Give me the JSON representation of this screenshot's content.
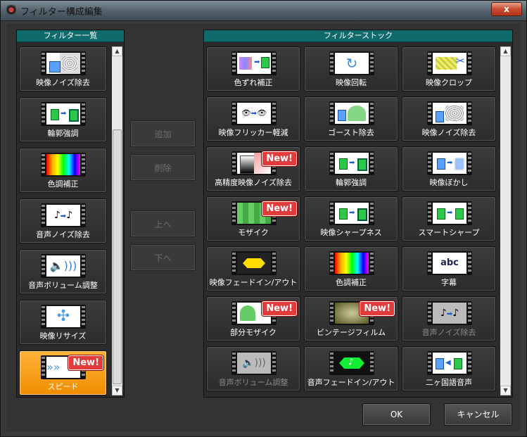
{
  "window": {
    "title": "フィルター構成編集",
    "close_label": "x"
  },
  "left_panel": {
    "header": "フィルター一覧",
    "items": [
      {
        "label": "映像ノイズ除去",
        "icon": "noise-icon"
      },
      {
        "label": "輪郭強調",
        "icon": "edge-icon"
      },
      {
        "label": "色調補正",
        "icon": "color-icon"
      },
      {
        "label": "音声ノイズ除去",
        "icon": "audio-noise-icon"
      },
      {
        "label": "音声ボリューム調整",
        "icon": "volume-icon"
      },
      {
        "label": "映像リサイズ",
        "icon": "resize-icon"
      },
      {
        "label": "スピード",
        "icon": "speed-icon",
        "badge": "New!"
      }
    ]
  },
  "middle_buttons": {
    "add": "追加",
    "delete": "削除",
    "up": "上へ",
    "down": "下へ"
  },
  "right_panel": {
    "header": "フィルターストック",
    "items": [
      {
        "label": "色ずれ補正"
      },
      {
        "label": "映像回転"
      },
      {
        "label": "映像クロップ"
      },
      {
        "label": "映像フリッカー軽減"
      },
      {
        "label": "ゴースト除去"
      },
      {
        "label": "映像ノイズ除去"
      },
      {
        "label": "高精度映像ノイズ除去",
        "badge": "New!"
      },
      {
        "label": "輪郭強調"
      },
      {
        "label": "映像ぼかし"
      },
      {
        "label": "モザイク",
        "badge": "New!"
      },
      {
        "label": "映像シャープネス"
      },
      {
        "label": "スマートシャープ"
      },
      {
        "label": "映像フェードイン/アウト"
      },
      {
        "label": "色調補正"
      },
      {
        "label": "字幕"
      },
      {
        "label": "部分モザイク",
        "badge": "New!"
      },
      {
        "label": "ビンテージフィルム",
        "badge": "New!"
      },
      {
        "label": "音声ノイズ除去"
      },
      {
        "label": "音声ボリューム調整"
      },
      {
        "label": "音声フェードイン/アウト"
      },
      {
        "label": "二ヶ国語音声"
      }
    ],
    "subtitle_icon_text": "abc"
  },
  "dialog_buttons": {
    "ok": "OK",
    "cancel": "キャンセル"
  },
  "colors": {
    "accent_header": "#0f6b6b",
    "selected": "#f08c00",
    "badge": "#e23b3b"
  }
}
